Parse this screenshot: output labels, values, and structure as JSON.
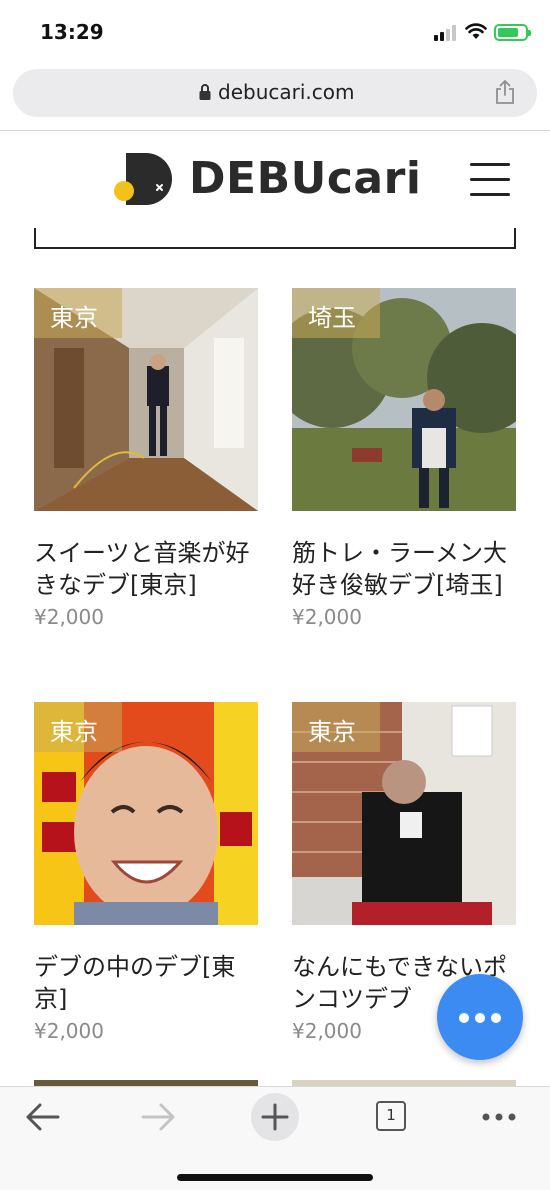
{
  "status_bar": {
    "time": "13:29"
  },
  "browser": {
    "url": "debucari.com",
    "tab_count": "1"
  },
  "site": {
    "logo_text": "DEBUcari"
  },
  "products": [
    {
      "region": "東京",
      "title": "スイーツと音楽が好きなデブ[東京]",
      "price": "¥2,000"
    },
    {
      "region": "埼玉",
      "title": "筋トレ・ラーメン大好き俊敏デブ[埼玉]",
      "price": "¥2,000"
    },
    {
      "region": "東京",
      "title": "デブの中のデブ[東京]",
      "price": "¥2,000"
    },
    {
      "region": "東京",
      "title": "なんにもできないポンコツデブ",
      "price": "¥2,000"
    }
  ],
  "colors": {
    "accent": "#3b8bf2",
    "logo_yellow": "#f2c21b",
    "battery": "#34c759"
  },
  "icons": [
    "lock-icon",
    "share-icon",
    "menu-icon",
    "more-icon",
    "back-icon",
    "forward-icon",
    "new-tab-icon",
    "tabs-icon",
    "browser-menu-icon"
  ]
}
